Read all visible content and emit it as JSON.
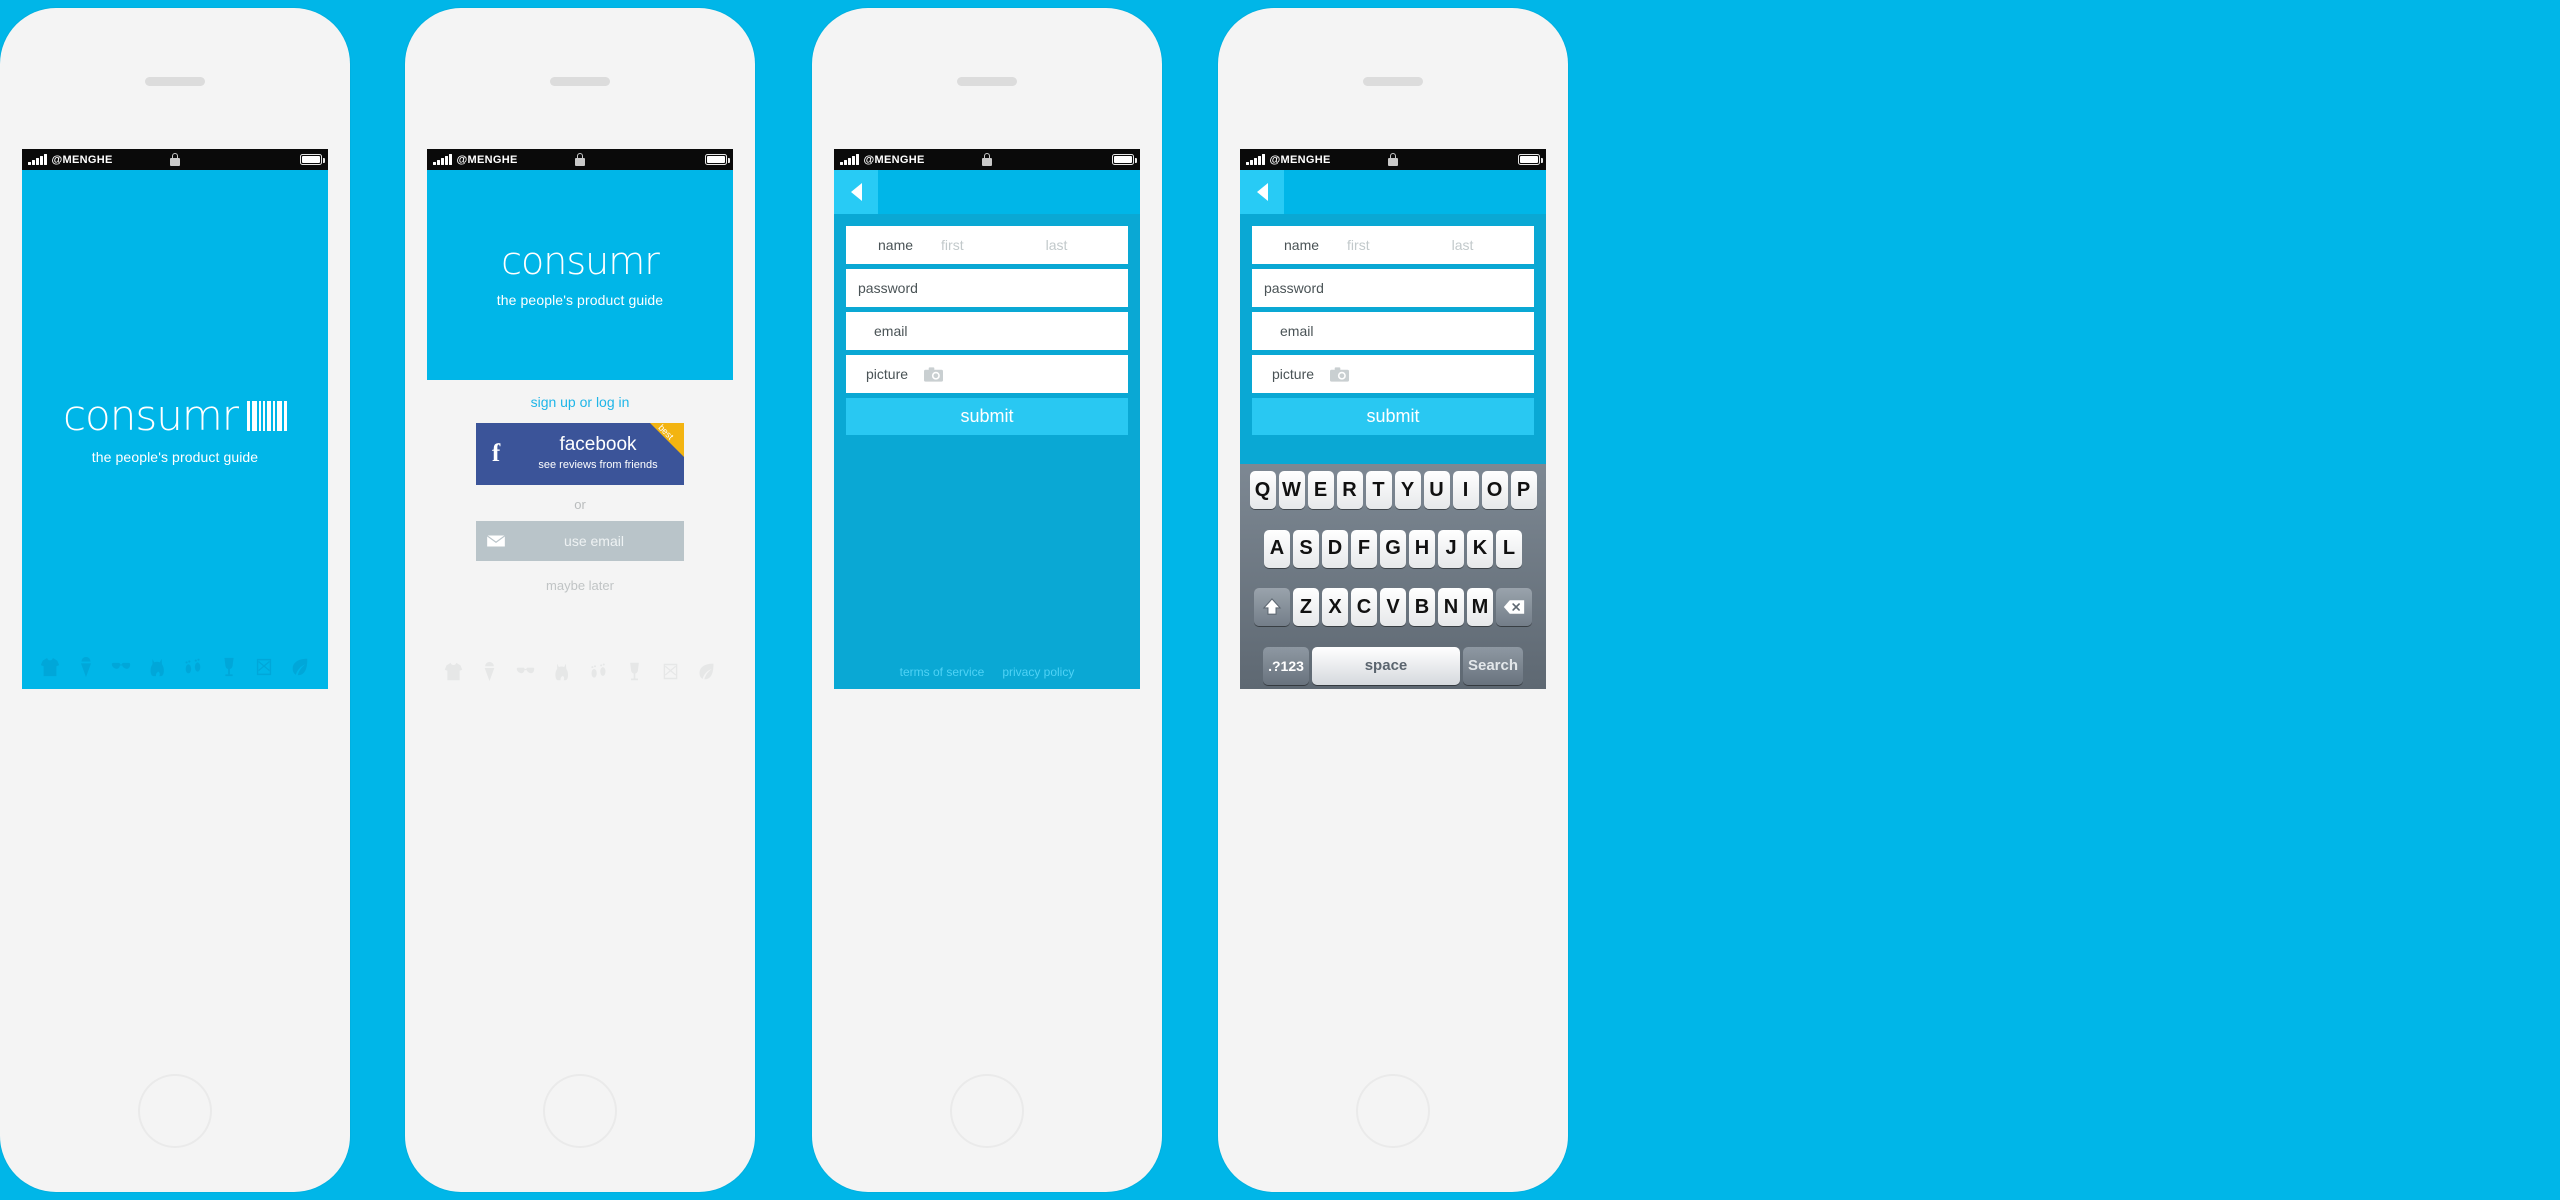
{
  "theme": {
    "brand_cyan": "#00b6e8",
    "form_cyan": "#0aa8d4",
    "accent_cyan": "#29c8f2",
    "facebook_blue": "#3b5499",
    "ribbon_yellow": "#f3b411",
    "page_background": "#00b6e8"
  },
  "status_bar": {
    "carrier": "@MENGHE",
    "signal_icon": "signal-bars-icon",
    "lock_icon": "lock-icon",
    "battery_icon": "battery-icon"
  },
  "branding": {
    "name": "consumr",
    "tagline": "the people's product guide",
    "barcode_icon": "barcode-icon"
  },
  "category_icons": [
    "tshirt-icon",
    "ice-cream-icon",
    "sunglasses-icon",
    "cat-icon",
    "footprints-icon",
    "wine-glass-icon",
    "barrel-icon",
    "leaf-icon"
  ],
  "screens": [
    {
      "id": "splash",
      "name": "splash-screen"
    },
    {
      "id": "login",
      "name": "login-screen"
    },
    {
      "id": "signup",
      "name": "signup-screen"
    },
    {
      "id": "signup-keyboard",
      "name": "signup-keyboard-screen"
    }
  ],
  "login": {
    "signup_or_login": "sign up or log in",
    "facebook": {
      "f_glyph": "f",
      "title": "facebook",
      "subtitle": "see reviews from friends",
      "ribbon_label": "best",
      "icon": "facebook-icon"
    },
    "or": "or",
    "email_button": {
      "label": "use email",
      "icon": "envelope-icon"
    },
    "maybe_later": "maybe later"
  },
  "signup": {
    "back_icon": "back-arrow-icon",
    "fields": {
      "name": {
        "label": "name",
        "first_placeholder": "first",
        "last_placeholder": "last",
        "value": ""
      },
      "password": {
        "label": "password",
        "value": ""
      },
      "email": {
        "label": "email",
        "value": ""
      },
      "picture": {
        "label": "picture",
        "icon": "camera-icon",
        "value": ""
      }
    },
    "submit_label": "submit",
    "footer": {
      "terms": "terms of service",
      "privacy": "privacy policy"
    }
  },
  "keyboard": {
    "row1": [
      "Q",
      "W",
      "E",
      "R",
      "T",
      "Y",
      "U",
      "I",
      "O",
      "P"
    ],
    "row2": [
      "A",
      "S",
      "D",
      "F",
      "G",
      "H",
      "J",
      "K",
      "L"
    ],
    "row3": [
      "Z",
      "X",
      "C",
      "V",
      "B",
      "N",
      "M"
    ],
    "shift_icon": "shift-icon",
    "delete_icon": "backspace-icon",
    "numeric_label": ".?123",
    "space_label": "space",
    "action_label": "Search"
  }
}
